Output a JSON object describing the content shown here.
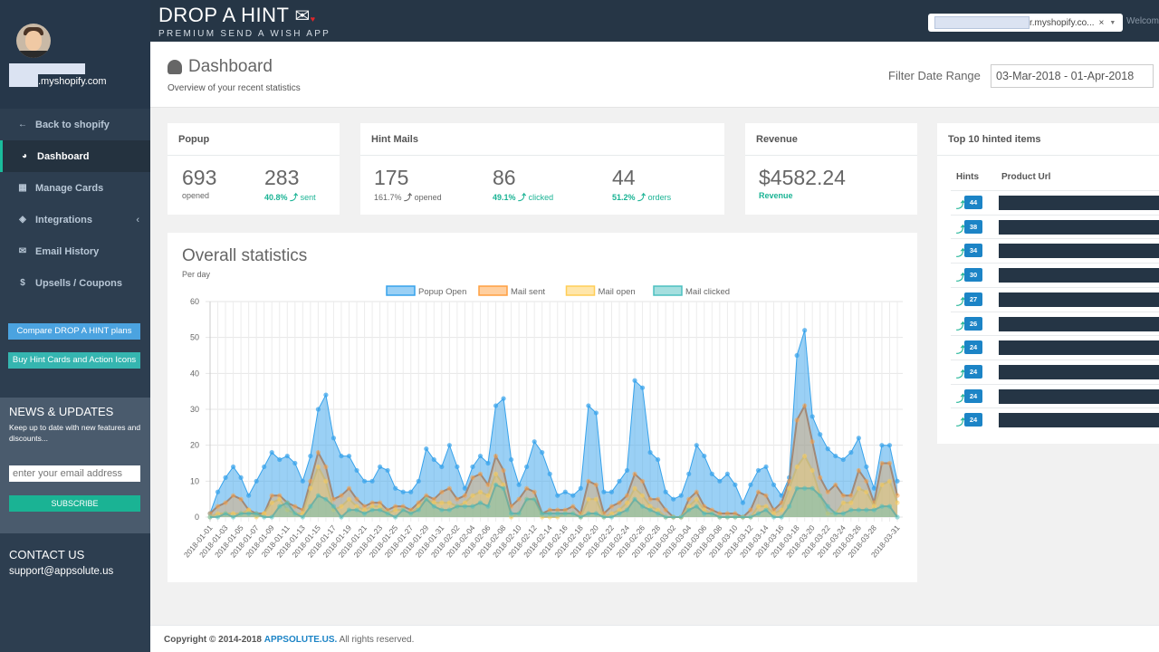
{
  "sidebar": {
    "shop_suffix": ".myshopify.com",
    "nav": [
      {
        "label": "Back to shopify",
        "icon": "arrow-left-icon",
        "glyph": "←"
      },
      {
        "label": "Dashboard",
        "icon": "pie-chart-icon",
        "glyph": "◕",
        "active": true
      },
      {
        "label": "Manage Cards",
        "icon": "grid-icon",
        "glyph": "▦"
      },
      {
        "label": "Integrations",
        "icon": "diamond-icon",
        "glyph": "◈",
        "chevron": "‹"
      },
      {
        "label": "Email History",
        "icon": "envelope-icon",
        "glyph": "✉"
      },
      {
        "label": "Upsells / Coupons",
        "icon": "dollar-icon",
        "glyph": "$"
      }
    ],
    "compare_button": "Compare DROP A HINT plans",
    "buy_button": "Buy Hint Cards and Action Icons",
    "news": {
      "title": "NEWS & UPDATES",
      "text": "Keep up to date with new features and discounts...",
      "email_placeholder": "enter your email address",
      "subscribe": "SUBSCRIBE"
    },
    "contact": {
      "title": "CONTACT US",
      "email": "support@appsolute.us"
    }
  },
  "topbar": {
    "logo_title": "DROP A HINT",
    "logo_tagline": "PREMIUM SEND A WISH APP",
    "store_select": "r.myshopify.co...",
    "store_clear": "×",
    "store_dropdown": "▼",
    "welcome": "Welcom"
  },
  "header": {
    "title": "Dashboard",
    "subtitle": "Overview of your recent statistics",
    "filter_label": "Filter Date Range",
    "date_range": "03-Mar-2018 - 01-Apr-2018"
  },
  "cards": {
    "popup": {
      "title": "Popup",
      "opened": "693",
      "opened_label": "opened",
      "sent": "283",
      "sent_pct": "40.8%",
      "sent_label": "sent"
    },
    "hint_mails": {
      "title": "Hint Mails",
      "opened": "175",
      "opened_pct": "161.7%",
      "opened_label": "opened",
      "clicked": "86",
      "clicked_pct": "49.1%",
      "clicked_label": "clicked",
      "orders": "44",
      "orders_pct": "51.2%",
      "orders_label": "orders"
    },
    "revenue": {
      "title": "Revenue",
      "value": "$4582.24",
      "label": "Revenue"
    }
  },
  "top10": {
    "title": "Top 10 hinted items",
    "col_hints": "Hints",
    "col_url": "Product Url",
    "hints": [
      "44",
      "38",
      "34",
      "30",
      "27",
      "26",
      "24",
      "24",
      "24",
      "24"
    ]
  },
  "chart_data": {
    "type": "area",
    "title": "Overall statistics",
    "subtitle": "Per day",
    "ylim": [
      0,
      60
    ],
    "yticks": [
      "0",
      "10",
      "20",
      "30",
      "40",
      "50",
      "60"
    ],
    "grid": true,
    "legend": "top",
    "x": [
      "2018-01-01",
      "2018-01-02",
      "2018-01-03",
      "2018-01-04",
      "2018-01-05",
      "2018-01-06",
      "2018-01-07",
      "2018-01-08",
      "2018-01-09",
      "2018-01-10",
      "2018-01-11",
      "2018-01-12",
      "2018-01-13",
      "2018-01-14",
      "2018-01-15",
      "2018-01-16",
      "2018-01-17",
      "2018-01-18",
      "2018-01-19",
      "2018-01-20",
      "2018-01-21",
      "2018-01-22",
      "2018-01-23",
      "2018-01-24",
      "2018-01-25",
      "2018-01-26",
      "2018-01-27",
      "2018-01-28",
      "2018-01-29",
      "2018-01-30",
      "2018-01-31",
      "2018-02-01",
      "2018-02-02",
      "2018-02-03",
      "2018-02-04",
      "2018-02-05",
      "2018-02-06",
      "2018-02-07",
      "2018-02-08",
      "2018-02-09",
      "2018-02-10",
      "2018-02-11",
      "2018-02-12",
      "2018-02-13",
      "2018-02-14",
      "2018-02-15",
      "2018-02-16",
      "2018-02-17",
      "2018-02-18",
      "2018-02-19",
      "2018-02-20",
      "2018-02-21",
      "2018-02-22",
      "2018-02-23",
      "2018-02-24",
      "2018-02-25",
      "2018-02-26",
      "2018-02-27",
      "2018-02-28",
      "2018-03-01",
      "2018-03-02",
      "2018-03-03",
      "2018-03-04",
      "2018-03-05",
      "2018-03-06",
      "2018-03-07",
      "2018-03-08",
      "2018-03-09",
      "2018-03-10",
      "2018-03-11",
      "2018-03-12",
      "2018-03-13",
      "2018-03-14",
      "2018-03-15",
      "2018-03-16",
      "2018-03-17",
      "2018-03-18",
      "2018-03-19",
      "2018-03-20",
      "2018-03-21",
      "2018-03-22",
      "2018-03-23",
      "2018-03-24",
      "2018-03-25",
      "2018-03-26",
      "2018-03-27",
      "2018-03-28",
      "2018-03-29",
      "2018-03-30",
      "2018-03-31"
    ],
    "series": [
      {
        "name": "Popup Open",
        "color": "#36a2eb",
        "values": [
          1,
          7,
          11,
          14,
          11,
          6,
          10,
          14,
          18,
          16,
          17,
          15,
          10,
          17,
          30,
          34,
          22,
          17,
          17,
          13,
          10,
          10,
          14,
          13,
          8,
          7,
          7,
          10,
          19,
          16,
          14,
          20,
          14,
          8,
          14,
          17,
          15,
          31,
          33,
          16,
          9,
          14,
          21,
          18,
          12,
          6,
          7,
          6,
          8,
          31,
          29,
          7,
          7,
          10,
          13,
          38,
          36,
          18,
          16,
          7,
          5,
          6,
          12,
          20,
          17,
          12,
          10,
          12,
          9,
          4,
          9,
          13,
          14,
          9,
          6,
          11,
          45,
          52,
          28,
          23,
          19,
          17,
          16,
          18,
          22,
          14,
          8,
          20,
          20,
          10
        ]
      },
      {
        "name": "Mail sent",
        "color": "#ff9f40",
        "values": [
          1,
          3,
          4,
          6,
          5,
          2,
          1,
          1,
          6,
          6,
          4,
          3,
          2,
          10,
          18,
          14,
          5,
          6,
          8,
          5,
          3,
          4,
          4,
          2,
          3,
          3,
          2,
          4,
          6,
          5,
          7,
          8,
          5,
          6,
          11,
          12,
          9,
          17,
          13,
          3,
          5,
          8,
          7,
          1,
          2,
          2,
          2,
          3,
          1,
          10,
          9,
          1,
          3,
          4,
          6,
          12,
          10,
          5,
          5,
          2,
          0,
          0,
          5,
          7,
          3,
          2,
          1,
          1,
          1,
          0,
          2,
          7,
          6,
          2,
          4,
          10,
          27,
          31,
          21,
          11,
          7,
          9,
          6,
          6,
          13,
          10,
          4,
          15,
          15,
          6
        ]
      },
      {
        "name": "Mail open",
        "color": "#ffcd56",
        "values": [
          0,
          1,
          1,
          1,
          1,
          2,
          0,
          1,
          4,
          5,
          2,
          1,
          1,
          8,
          14,
          10,
          2,
          3,
          5,
          3,
          2,
          3,
          3,
          1,
          2,
          2,
          1,
          3,
          5,
          4,
          4,
          4,
          3,
          4,
          6,
          7,
          6,
          12,
          9,
          0,
          1,
          5,
          5,
          0,
          0,
          0,
          1,
          1,
          0,
          5,
          5,
          0,
          1,
          2,
          4,
          8,
          6,
          3,
          2,
          0,
          0,
          0,
          3,
          5,
          2,
          1,
          0,
          0,
          0,
          0,
          0,
          3,
          3,
          1,
          2,
          8,
          14,
          17,
          13,
          6,
          1,
          1,
          4,
          4,
          8,
          7,
          3,
          9,
          10,
          4
        ]
      },
      {
        "name": "Mail clicked",
        "color": "#4bc0c0",
        "values": [
          0,
          0,
          1,
          0,
          1,
          1,
          1,
          0,
          0,
          3,
          4,
          1,
          0,
          3,
          6,
          5,
          3,
          0,
          2,
          2,
          1,
          2,
          2,
          1,
          0,
          2,
          1,
          2,
          5,
          3,
          2,
          2,
          3,
          3,
          3,
          4,
          3,
          9,
          8,
          1,
          1,
          5,
          5,
          1,
          1,
          1,
          1,
          1,
          0,
          1,
          1,
          0,
          0,
          1,
          2,
          5,
          3,
          2,
          1,
          0,
          0,
          0,
          2,
          3,
          1,
          1,
          0,
          0,
          0,
          0,
          0,
          1,
          2,
          0,
          0,
          3,
          8,
          8,
          8,
          6,
          3,
          1,
          1,
          2,
          2,
          2,
          2,
          3,
          3,
          0
        ]
      }
    ]
  },
  "footer": {
    "prefix": "Copyright © 2014-2018",
    "brand": "APPSOLUTE.US.",
    "suffix": "All rights reserved."
  }
}
